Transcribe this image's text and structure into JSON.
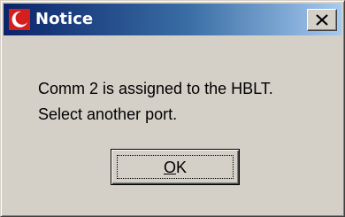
{
  "window": {
    "title": "Notice",
    "app_icon": "red-crescent-icon",
    "close_glyph": "close-icon"
  },
  "message": {
    "line1": "Comm 2 is assigned to the HBLT.",
    "line2": "Select another port."
  },
  "buttons": {
    "ok_mnemonic": "O",
    "ok_rest": "K"
  },
  "colors": {
    "titlebar_start": "#0a246a",
    "titlebar_end": "#a6caf0",
    "dialog_face": "#d4d0c8",
    "icon_red": "#d51f1f"
  }
}
